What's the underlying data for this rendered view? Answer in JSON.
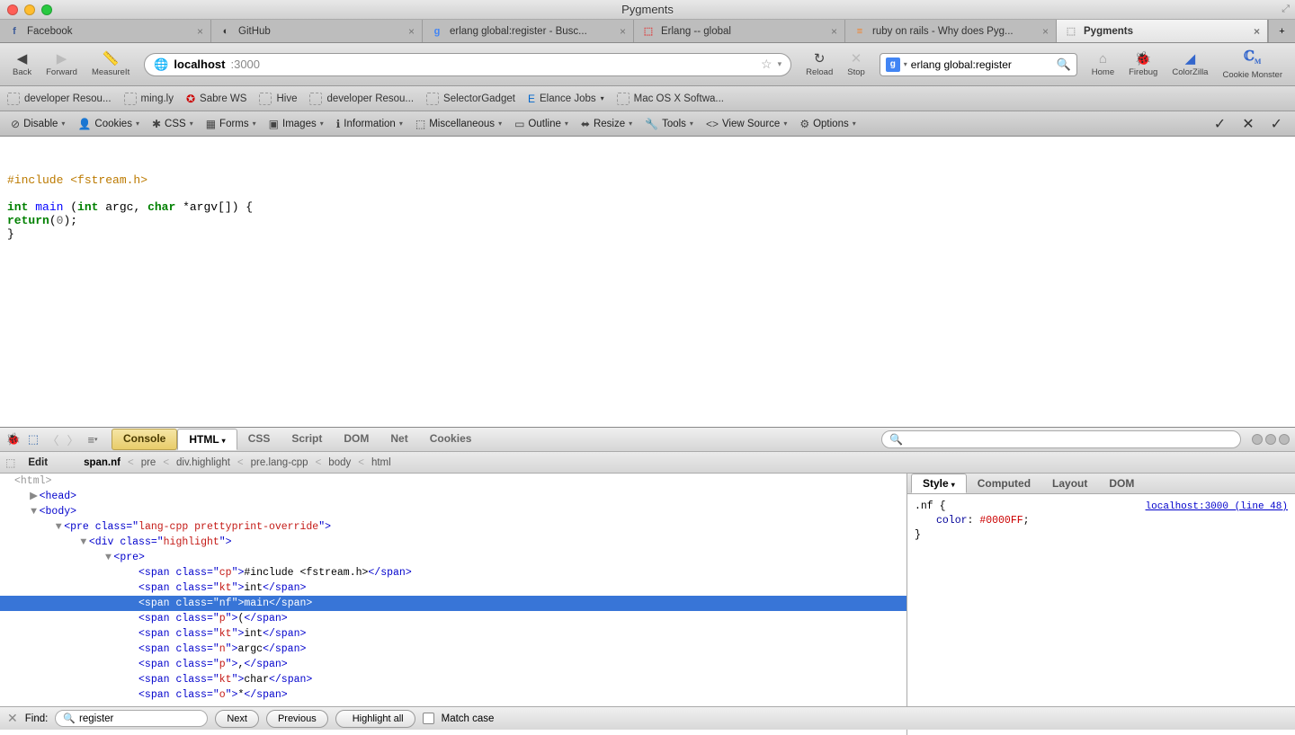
{
  "window": {
    "title": "Pygments"
  },
  "tabs": [
    {
      "label": "Facebook",
      "favicon": "f",
      "favcolor": "#3b5998"
    },
    {
      "label": "GitHub",
      "favicon": "◐",
      "favcolor": "#333"
    },
    {
      "label": "erlang global:register - Busc...",
      "favicon": "g",
      "favcolor": "#4285f4"
    },
    {
      "label": "Erlang -- global",
      "favicon": "⬚",
      "favcolor": "#d44"
    },
    {
      "label": "ruby on rails - Why does Pyg...",
      "favicon": "≡",
      "favcolor": "#f48024"
    },
    {
      "label": "Pygments",
      "favicon": "⬚",
      "favcolor": "#aaa",
      "active": true
    }
  ],
  "nav": {
    "back": "Back",
    "forward": "Forward",
    "measureit": "MeasureIt",
    "url_host": "localhost",
    "url_rest": ":3000",
    "reload": "Reload",
    "stop": "Stop",
    "search_value": "erlang global:register",
    "home": "Home",
    "firebug": "Firebug",
    "colorzilla": "ColorZilla",
    "cookiemonster": "Cookie Monster"
  },
  "bookmarks": [
    "developer Resou...",
    "ming.ly",
    "Sabre WS",
    "Hive",
    "developer Resou...",
    "SelectorGadget",
    "Elance Jobs",
    "Mac OS X Softwa..."
  ],
  "webdev": [
    "Disable",
    "Cookies",
    "CSS",
    "Forms",
    "Images",
    "Information",
    "Miscellaneous",
    "Outline",
    "Resize",
    "Tools",
    "View Source",
    "Options"
  ],
  "code": {
    "include": "#include <fstream.h>",
    "int1": "int",
    "main": "main",
    "paren_open": " (",
    "int2": "int",
    "argc": " argc, ",
    "char": "char",
    "argv": " *argv[]) {",
    "return": "return",
    "paren0": "(",
    "zero": "0",
    "paren_close": ");",
    "close": "}"
  },
  "firebug": {
    "tabs": {
      "console": "Console",
      "html": "HTML",
      "css": "CSS",
      "script": "Script",
      "dom": "DOM",
      "net": "Net",
      "cookies": "Cookies"
    },
    "crumbs": {
      "edit": "Edit",
      "c1": "span.nf",
      "c2": "pre",
      "c3": "div.highlight",
      "c4": "pre.lang-cpp",
      "c5": "body",
      "c6": "html"
    },
    "side_tabs": {
      "style": "Style",
      "computed": "Computed",
      "layout": "Layout",
      "dom": "DOM"
    },
    "css": {
      "selector": ".nf {",
      "prop": "color",
      "val": "#0000FF",
      "close": "}",
      "source": "localhost:3000 (line 48)"
    },
    "dom_lines": [
      {
        "indent": 0,
        "twist": "",
        "open": "<html>",
        "faded": true
      },
      {
        "indent": 1,
        "twist": "▶",
        "open": "<head>"
      },
      {
        "indent": 1,
        "twist": "▼",
        "open": "<body>"
      },
      {
        "indent": 2,
        "twist": "▼",
        "open": "<pre class=\"",
        "val": "lang-cpp prettyprint-override",
        "tail": "\">"
      },
      {
        "indent": 3,
        "twist": "▼",
        "open": "<div class=\"",
        "val": "highlight",
        "tail": "\">"
      },
      {
        "indent": 4,
        "twist": "▼",
        "open": "<pre>"
      },
      {
        "indent": 5,
        "twist": "",
        "open": "<span class=\"",
        "val": "cp",
        "tail": "\">",
        "text": "#include <fstream.h>",
        "close": "</span>"
      },
      {
        "indent": 5,
        "twist": "",
        "open": "<span class=\"",
        "val": "kt",
        "tail": "\">",
        "text": "int",
        "close": "</span>"
      },
      {
        "indent": 5,
        "twist": "",
        "open": "<span class=\"",
        "val": "nf",
        "tail": "\">",
        "text": "main",
        "close": "</span>",
        "selected": true
      },
      {
        "indent": 5,
        "twist": "",
        "open": "<span class=\"",
        "val": "p",
        "tail": "\">",
        "text": "(",
        "close": "</span>"
      },
      {
        "indent": 5,
        "twist": "",
        "open": "<span class=\"",
        "val": "kt",
        "tail": "\">",
        "text": "int",
        "close": "</span>"
      },
      {
        "indent": 5,
        "twist": "",
        "open": "<span class=\"",
        "val": "n",
        "tail": "\">",
        "text": "argc",
        "close": "</span>"
      },
      {
        "indent": 5,
        "twist": "",
        "open": "<span class=\"",
        "val": "p",
        "tail": "\">",
        "text": ",",
        "close": "</span>"
      },
      {
        "indent": 5,
        "twist": "",
        "open": "<span class=\"",
        "val": "kt",
        "tail": "\">",
        "text": "char",
        "close": "</span>"
      },
      {
        "indent": 5,
        "twist": "",
        "open": "<span class=\"",
        "val": "o",
        "tail": "\">",
        "text": "*",
        "close": "</span>"
      }
    ]
  },
  "findbar": {
    "label": "Find:",
    "value": "register",
    "next": "Next",
    "prev": "Previous",
    "hl": "Highlight all",
    "match": "Match case"
  }
}
